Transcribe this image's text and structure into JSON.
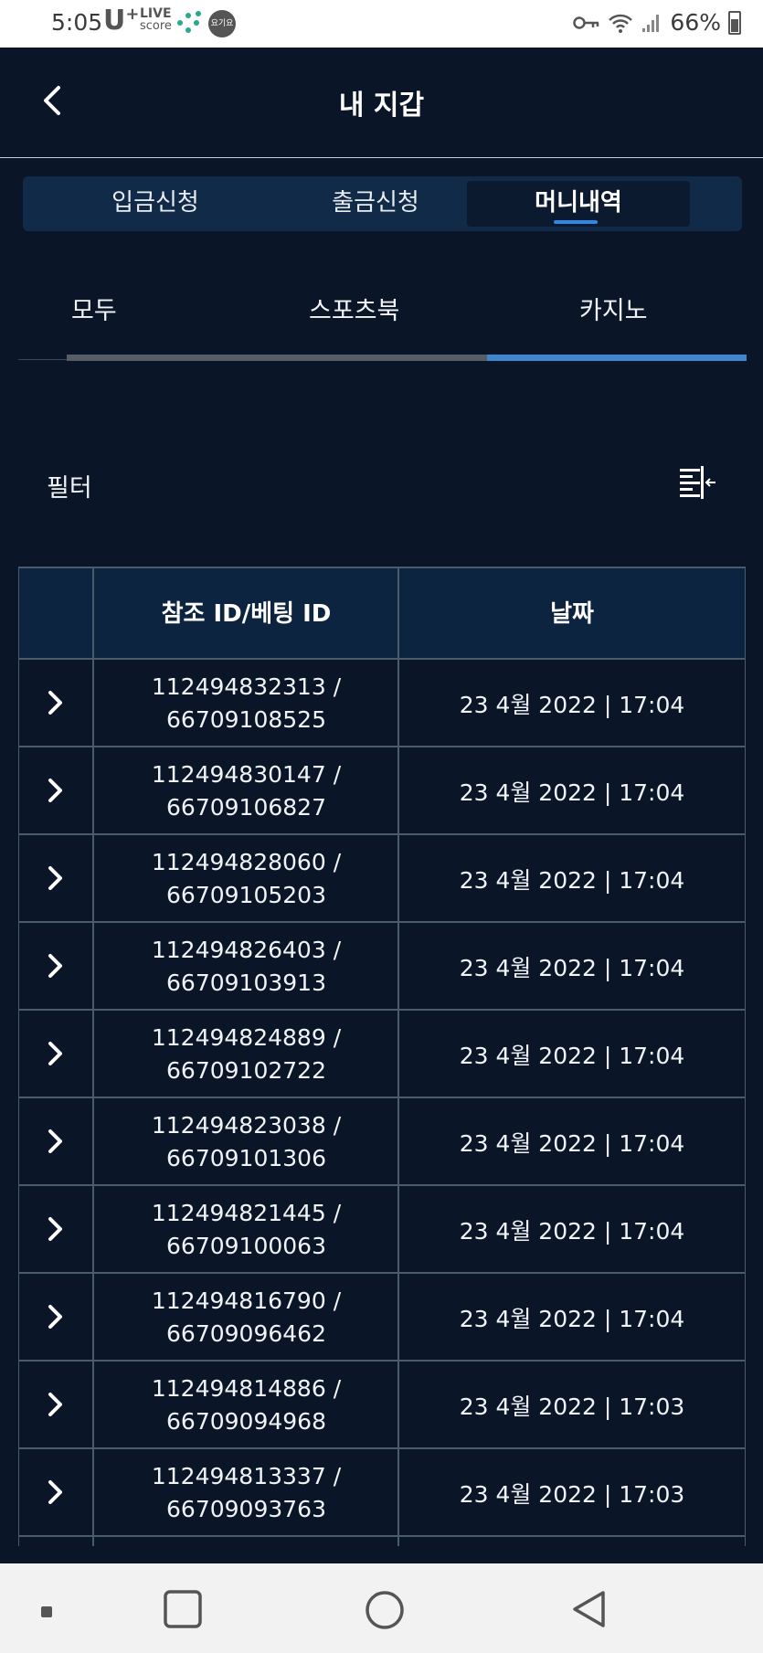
{
  "status_bar": {
    "time": "5:05",
    "carrier": "U",
    "carrier_sup": "+",
    "live_app": "LIVE",
    "live_app_sub": "score",
    "app_badge": "요기요",
    "battery": "66%"
  },
  "header": {
    "title": "내 지갑"
  },
  "tabs": [
    {
      "label": "입금신청",
      "active": false
    },
    {
      "label": "출금신청",
      "active": false
    },
    {
      "label": "머니내역",
      "active": true
    }
  ],
  "subtabs": [
    {
      "label": "모두",
      "active": false
    },
    {
      "label": "스포츠북",
      "active": false
    },
    {
      "label": "카지노",
      "active": true
    }
  ],
  "filter": {
    "label": "필터"
  },
  "table": {
    "headers": [
      "",
      "참조 ID/베팅 ID",
      "날짜"
    ],
    "rows": [
      {
        "ref_id": "112494832313 /",
        "bet_id": "66709108525",
        "date": "23 4월 2022 | 17:04"
      },
      {
        "ref_id": "112494830147 /",
        "bet_id": "66709106827",
        "date": "23 4월 2022 | 17:04"
      },
      {
        "ref_id": "112494828060 /",
        "bet_id": "66709105203",
        "date": "23 4월 2022 | 17:04"
      },
      {
        "ref_id": "112494826403 /",
        "bet_id": "66709103913",
        "date": "23 4월 2022 | 17:04"
      },
      {
        "ref_id": "112494824889 /",
        "bet_id": "66709102722",
        "date": "23 4월 2022 | 17:04"
      },
      {
        "ref_id": "112494823038 /",
        "bet_id": "66709101306",
        "date": "23 4월 2022 | 17:04"
      },
      {
        "ref_id": "112494821445 /",
        "bet_id": "66709100063",
        "date": "23 4월 2022 | 17:04"
      },
      {
        "ref_id": "112494816790 /",
        "bet_id": "66709096462",
        "date": "23 4월 2022 | 17:04"
      },
      {
        "ref_id": "112494814886 /",
        "bet_id": "66709094968",
        "date": "23 4월 2022 | 17:03"
      },
      {
        "ref_id": "112494813337 /",
        "bet_id": "66709093763",
        "date": "23 4월 2022 | 17:03"
      }
    ]
  },
  "colors": {
    "background": "#0a1628",
    "tab_bar": "#112a48",
    "accent_blue": "#3f86cf",
    "grid_line": "#4b5b6e"
  },
  "icons": {
    "back": "chevron-left-icon",
    "filter": "filter-columns-icon",
    "row_expand": "chevron-right-icon",
    "nav_recent": "recent-apps-icon",
    "nav_home": "home-icon",
    "nav_back": "back-triangle-icon"
  }
}
